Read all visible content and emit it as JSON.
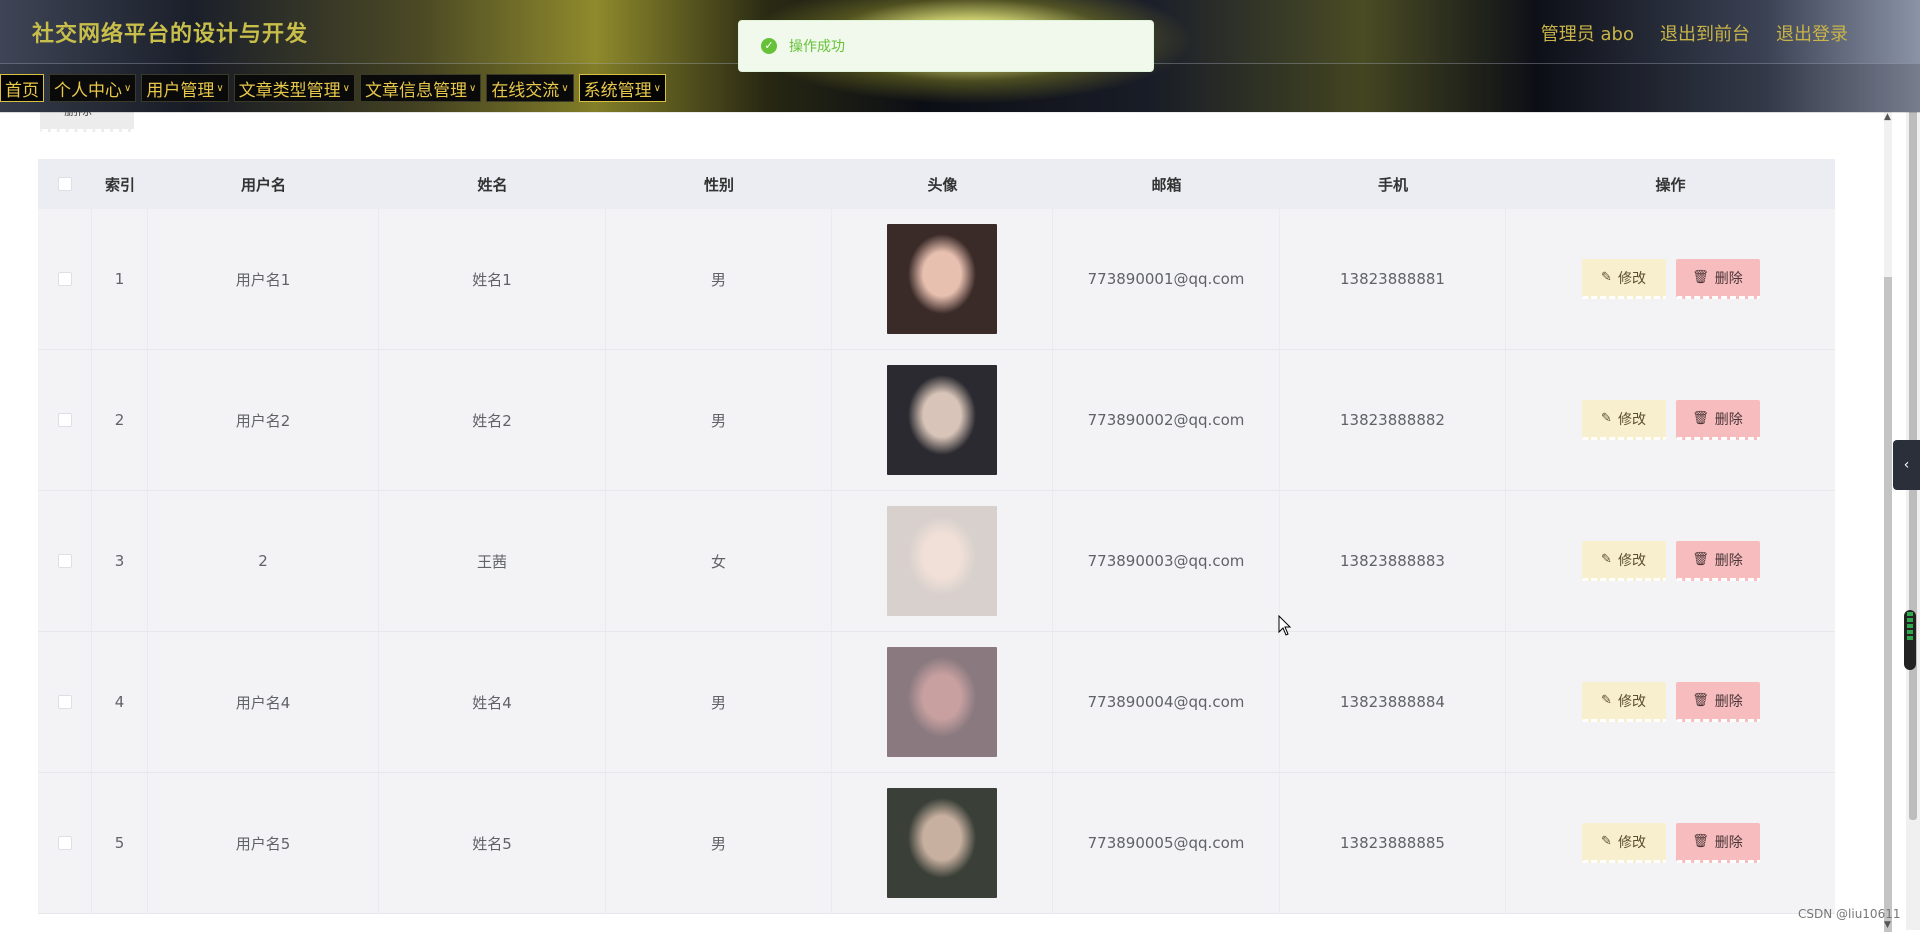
{
  "header": {
    "title": "社交网络平台的设计与开发",
    "admin_label": "管理员 abo",
    "to_frontend": "退出到前台",
    "logout": "退出登录"
  },
  "nav": [
    {
      "label": "首页",
      "dropdown": false
    },
    {
      "label": "个人中心",
      "dropdown": true
    },
    {
      "label": "用户管理",
      "dropdown": true
    },
    {
      "label": "文章类型管理",
      "dropdown": true
    },
    {
      "label": "文章信息管理",
      "dropdown": true
    },
    {
      "label": "在线交流",
      "dropdown": true
    },
    {
      "label": "系统管理",
      "dropdown": true
    }
  ],
  "toast": {
    "message": "操作成功",
    "icon": "check-circle-icon",
    "color": "#67c23a"
  },
  "toolbar": {
    "delete_label": "删除"
  },
  "table": {
    "headers": {
      "index": "索引",
      "username": "用户名",
      "name": "姓名",
      "gender": "性别",
      "avatar": "头像",
      "email": "邮箱",
      "phone": "手机",
      "actions": "操作"
    },
    "rows": [
      {
        "index": "1",
        "username": "用户名1",
        "name": "姓名1",
        "gender": "男",
        "email": "773890001@qq.com",
        "phone": "13823888881"
      },
      {
        "index": "2",
        "username": "用户名2",
        "name": "姓名2",
        "gender": "男",
        "email": "773890002@qq.com",
        "phone": "13823888882"
      },
      {
        "index": "3",
        "username": "2",
        "name": "王茜",
        "gender": "女",
        "email": "773890003@qq.com",
        "phone": "13823888883"
      },
      {
        "index": "4",
        "username": "用户名4",
        "name": "姓名4",
        "gender": "男",
        "email": "773890004@qq.com",
        "phone": "13823888884"
      },
      {
        "index": "5",
        "username": "用户名5",
        "name": "姓名5",
        "gender": "男",
        "email": "773890005@qq.com",
        "phone": "13823888885"
      }
    ],
    "edit_label": "修改",
    "delete_label": "删除"
  },
  "watermark": "CSDN @liu10611",
  "colors": {
    "accent_gold": "#e8c84a",
    "edit_btn": "#f8efce",
    "delete_btn": "#f6bcbe",
    "success": "#67c23a"
  }
}
